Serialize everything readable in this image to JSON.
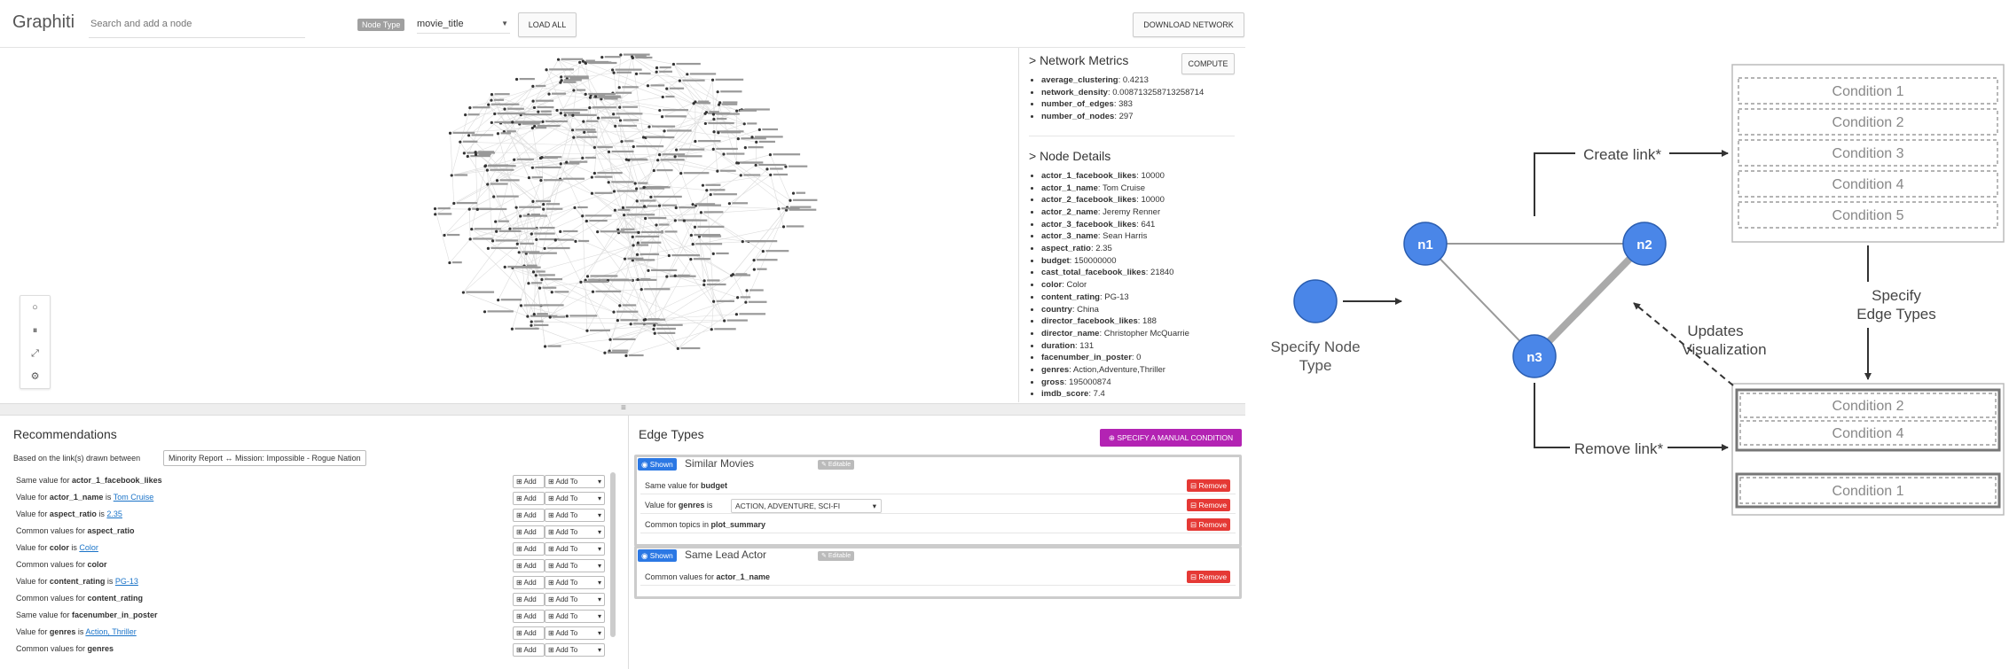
{
  "app": {
    "title": "Graphiti",
    "search_placeholder": "Search and add a node",
    "node_type_label": "Node Type",
    "node_type_value": "movie_title",
    "load_all_label": "LOAD ALL",
    "download_label": "DOWNLOAD NETWORK"
  },
  "controls": {
    "icons": [
      "reset-icon",
      "pause-icon",
      "fit-icon",
      "settings-icon"
    ],
    "glyphs": [
      "○",
      "⏸",
      "⤢",
      "⚙"
    ]
  },
  "metrics": {
    "title": "> Network Metrics",
    "compute_label": "COMPUTE",
    "items": [
      {
        "key": "average_clustering",
        "value": ": 0.4213"
      },
      {
        "key": "network_density",
        "value": ": 0.008713258713258714"
      },
      {
        "key": "number_of_edges",
        "value": ": 383"
      },
      {
        "key": "number_of_nodes",
        "value": ": 297"
      }
    ]
  },
  "node_details": {
    "title": "> Node Details",
    "items": [
      {
        "key": "actor_1_facebook_likes",
        "value": ": 10000"
      },
      {
        "key": "actor_1_name",
        "value": ": Tom Cruise"
      },
      {
        "key": "actor_2_facebook_likes",
        "value": ": 10000"
      },
      {
        "key": "actor_2_name",
        "value": ": Jeremy Renner"
      },
      {
        "key": "actor_3_facebook_likes",
        "value": ": 641"
      },
      {
        "key": "actor_3_name",
        "value": ": Sean Harris"
      },
      {
        "key": "aspect_ratio",
        "value": ": 2.35"
      },
      {
        "key": "budget",
        "value": ": 150000000"
      },
      {
        "key": "cast_total_facebook_likes",
        "value": ": 21840"
      },
      {
        "key": "color",
        "value": ": Color"
      },
      {
        "key": "content_rating",
        "value": ": PG-13"
      },
      {
        "key": "country",
        "value": ": China"
      },
      {
        "key": "director_facebook_likes",
        "value": ": 188"
      },
      {
        "key": "director_name",
        "value": ": Christopher McQuarrie"
      },
      {
        "key": "duration",
        "value": ": 131"
      },
      {
        "key": "facenumber_in_poster",
        "value": ": 0"
      },
      {
        "key": "genres",
        "value": ": Action,Adventure,Thriller"
      },
      {
        "key": "gross",
        "value": ": 195000874"
      },
      {
        "key": "imdb_score",
        "value": ": 7.4"
      }
    ]
  },
  "recommendations": {
    "title": "Recommendations",
    "between_label": "Based on the link(s) drawn between",
    "between_value": "Minority Report ↔ Mission: Impossible - Rogue Nation",
    "add_label": "Add",
    "add_to_label": "Add To",
    "rows": [
      {
        "prefix": "Same value for ",
        "field": "actor_1_facebook_likes",
        "mid": "",
        "link": ""
      },
      {
        "prefix": "Value for ",
        "field": "actor_1_name",
        "mid": " is ",
        "link": "Tom Cruise"
      },
      {
        "prefix": "Value for ",
        "field": "aspect_ratio",
        "mid": " is ",
        "link": "2.35"
      },
      {
        "prefix": "Common values for ",
        "field": "aspect_ratio",
        "mid": "",
        "link": ""
      },
      {
        "prefix": "Value for ",
        "field": "color",
        "mid": " is ",
        "link": "Color"
      },
      {
        "prefix": "Common values for ",
        "field": "color",
        "mid": "",
        "link": ""
      },
      {
        "prefix": "Value for ",
        "field": "content_rating",
        "mid": " is ",
        "link": "PG-13"
      },
      {
        "prefix": "Common values for ",
        "field": "content_rating",
        "mid": "",
        "link": ""
      },
      {
        "prefix": "Same value for ",
        "field": "facenumber_in_poster",
        "mid": "",
        "link": ""
      },
      {
        "prefix": "Value for ",
        "field": "genres",
        "mid": " is ",
        "link": "Action, Thriller"
      },
      {
        "prefix": "Common values for ",
        "field": "genres",
        "mid": "",
        "link": ""
      }
    ]
  },
  "edge_types": {
    "title": "Edge Types",
    "manual_label": "SPECIFY A MANUAL CONDITION",
    "shown_label": "Shown",
    "editable_label": "Editable",
    "remove_label": "Remove",
    "cards": [
      {
        "name": "Similar Movies",
        "rows": [
          {
            "prefix": "Same value for ",
            "field": "budget",
            "select": ""
          },
          {
            "prefix": "Value for ",
            "field": "genres",
            "mid": " is ",
            "select": "ACTION, ADVENTURE, SCI-FI"
          },
          {
            "prefix": "Common topics in ",
            "field": "plot_summary",
            "select": ""
          }
        ]
      },
      {
        "name": "Same Lead Actor",
        "rows": [
          {
            "prefix": "Common values for ",
            "field": "actor_1_name",
            "select": ""
          }
        ]
      }
    ]
  },
  "diagram": {
    "nodes": [
      "n1",
      "n2",
      "n3"
    ],
    "specify_node_type": [
      "Specify Node",
      "Type"
    ],
    "create_link": "Create link*",
    "remove_link": "Remove link*",
    "specify_edge_types": [
      "Specify",
      "Edge Types"
    ],
    "updates_visualization": [
      "Updates",
      "Visualization"
    ],
    "conditions_top": [
      "Condition 1",
      "Condition 2",
      "Condition 3",
      "Condition 4",
      "Condition 5"
    ],
    "conditions_bottom_group": [
      "Condition 2",
      "Condition 4"
    ],
    "conditions_bottom_single": "Condition 1",
    "node_color": "#4a86e8"
  }
}
